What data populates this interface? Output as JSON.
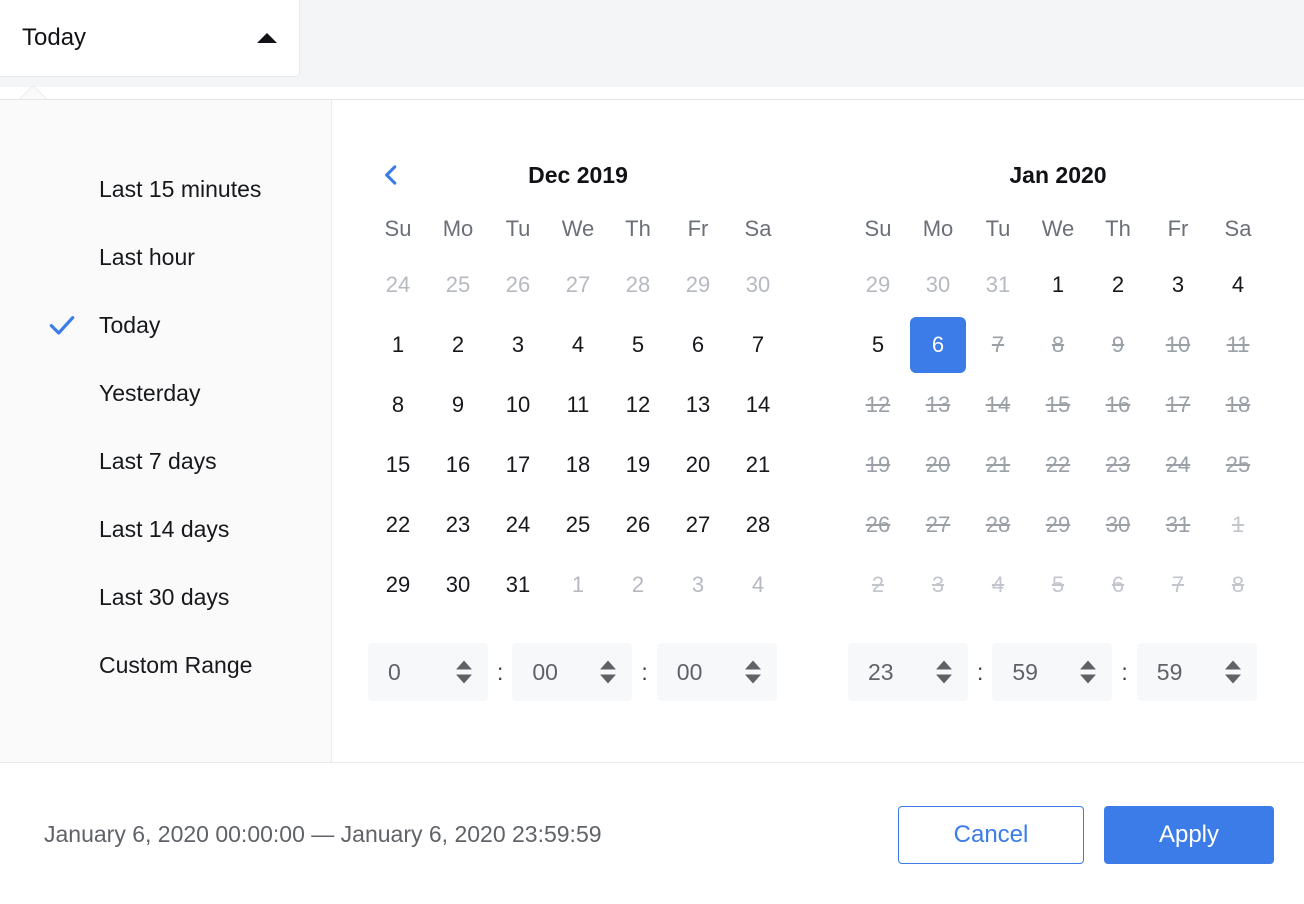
{
  "trigger": {
    "label": "Today",
    "caret_icon": "caret-up-icon"
  },
  "sidebar": {
    "items": [
      {
        "label": "Last 15 minutes",
        "selected": false
      },
      {
        "label": "Last hour",
        "selected": false
      },
      {
        "label": "Today",
        "selected": true
      },
      {
        "label": "Yesterday",
        "selected": false
      },
      {
        "label": "Last 7 days",
        "selected": false
      },
      {
        "label": "Last 14 days",
        "selected": false
      },
      {
        "label": "Last 30 days",
        "selected": false
      },
      {
        "label": "Custom Range",
        "selected": false
      }
    ],
    "check_icon": "check-icon"
  },
  "calendars": [
    {
      "title": "Dec 2019",
      "has_prev_nav": true,
      "prev_icon": "chevron-left-icon",
      "dow": [
        "Su",
        "Mo",
        "Tu",
        "We",
        "Th",
        "Fr",
        "Sa"
      ],
      "weeks": [
        [
          {
            "d": "24",
            "state": "muted"
          },
          {
            "d": "25",
            "state": "muted"
          },
          {
            "d": "26",
            "state": "muted"
          },
          {
            "d": "27",
            "state": "muted"
          },
          {
            "d": "28",
            "state": "muted"
          },
          {
            "d": "29",
            "state": "muted"
          },
          {
            "d": "30",
            "state": "muted"
          }
        ],
        [
          {
            "d": "1",
            "state": "normal"
          },
          {
            "d": "2",
            "state": "normal"
          },
          {
            "d": "3",
            "state": "normal"
          },
          {
            "d": "4",
            "state": "normal"
          },
          {
            "d": "5",
            "state": "normal"
          },
          {
            "d": "6",
            "state": "normal"
          },
          {
            "d": "7",
            "state": "normal"
          }
        ],
        [
          {
            "d": "8",
            "state": "normal"
          },
          {
            "d": "9",
            "state": "normal"
          },
          {
            "d": "10",
            "state": "normal"
          },
          {
            "d": "11",
            "state": "normal"
          },
          {
            "d": "12",
            "state": "normal"
          },
          {
            "d": "13",
            "state": "normal"
          },
          {
            "d": "14",
            "state": "normal"
          }
        ],
        [
          {
            "d": "15",
            "state": "normal"
          },
          {
            "d": "16",
            "state": "normal"
          },
          {
            "d": "17",
            "state": "normal"
          },
          {
            "d": "18",
            "state": "normal"
          },
          {
            "d": "19",
            "state": "normal"
          },
          {
            "d": "20",
            "state": "normal"
          },
          {
            "d": "21",
            "state": "normal"
          }
        ],
        [
          {
            "d": "22",
            "state": "normal"
          },
          {
            "d": "23",
            "state": "normal"
          },
          {
            "d": "24",
            "state": "normal"
          },
          {
            "d": "25",
            "state": "normal"
          },
          {
            "d": "26",
            "state": "normal"
          },
          {
            "d": "27",
            "state": "normal"
          },
          {
            "d": "28",
            "state": "normal"
          }
        ],
        [
          {
            "d": "29",
            "state": "normal"
          },
          {
            "d": "30",
            "state": "normal"
          },
          {
            "d": "31",
            "state": "normal"
          },
          {
            "d": "1",
            "state": "muted"
          },
          {
            "d": "2",
            "state": "muted"
          },
          {
            "d": "3",
            "state": "muted"
          },
          {
            "d": "4",
            "state": "muted"
          }
        ]
      ]
    },
    {
      "title": "Jan 2020",
      "has_prev_nav": false,
      "prev_icon": "",
      "dow": [
        "Su",
        "Mo",
        "Tu",
        "We",
        "Th",
        "Fr",
        "Sa"
      ],
      "weeks": [
        [
          {
            "d": "29",
            "state": "muted"
          },
          {
            "d": "30",
            "state": "muted"
          },
          {
            "d": "31",
            "state": "muted"
          },
          {
            "d": "1",
            "state": "normal"
          },
          {
            "d": "2",
            "state": "normal"
          },
          {
            "d": "3",
            "state": "normal"
          },
          {
            "d": "4",
            "state": "normal"
          }
        ],
        [
          {
            "d": "5",
            "state": "normal"
          },
          {
            "d": "6",
            "state": "selected"
          },
          {
            "d": "7",
            "state": "disabled"
          },
          {
            "d": "8",
            "state": "disabled"
          },
          {
            "d": "9",
            "state": "disabled"
          },
          {
            "d": "10",
            "state": "disabled"
          },
          {
            "d": "11",
            "state": "disabled"
          }
        ],
        [
          {
            "d": "12",
            "state": "disabled"
          },
          {
            "d": "13",
            "state": "disabled"
          },
          {
            "d": "14",
            "state": "disabled"
          },
          {
            "d": "15",
            "state": "disabled"
          },
          {
            "d": "16",
            "state": "disabled"
          },
          {
            "d": "17",
            "state": "disabled"
          },
          {
            "d": "18",
            "state": "disabled"
          }
        ],
        [
          {
            "d": "19",
            "state": "disabled"
          },
          {
            "d": "20",
            "state": "disabled"
          },
          {
            "d": "21",
            "state": "disabled"
          },
          {
            "d": "22",
            "state": "disabled"
          },
          {
            "d": "23",
            "state": "disabled"
          },
          {
            "d": "24",
            "state": "disabled"
          },
          {
            "d": "25",
            "state": "disabled"
          }
        ],
        [
          {
            "d": "26",
            "state": "disabled"
          },
          {
            "d": "27",
            "state": "disabled"
          },
          {
            "d": "28",
            "state": "disabled"
          },
          {
            "d": "29",
            "state": "disabled"
          },
          {
            "d": "30",
            "state": "disabled"
          },
          {
            "d": "31",
            "state": "disabled"
          },
          {
            "d": "1",
            "state": "muted disabled"
          }
        ],
        [
          {
            "d": "2",
            "state": "muted disabled"
          },
          {
            "d": "3",
            "state": "muted disabled"
          },
          {
            "d": "4",
            "state": "muted disabled"
          },
          {
            "d": "5",
            "state": "muted disabled"
          },
          {
            "d": "6",
            "state": "muted disabled"
          },
          {
            "d": "7",
            "state": "muted disabled"
          },
          {
            "d": "8",
            "state": "muted disabled"
          }
        ]
      ]
    }
  ],
  "time": {
    "start": {
      "hour": "0",
      "minute": "00",
      "second": "00"
    },
    "end": {
      "hour": "23",
      "minute": "59",
      "second": "59"
    },
    "separator": ":"
  },
  "footer": {
    "range_summary": "January 6, 2020 00:00:00 — January 6, 2020 23:59:59",
    "cancel_label": "Cancel",
    "apply_label": "Apply"
  },
  "colors": {
    "accent": "#3b7ce8",
    "header_bg": "#f4f5f7",
    "sidebar_bg": "#fafafa",
    "muted_text": "#b6bac0",
    "disabled_text": "#9aa0a6"
  }
}
